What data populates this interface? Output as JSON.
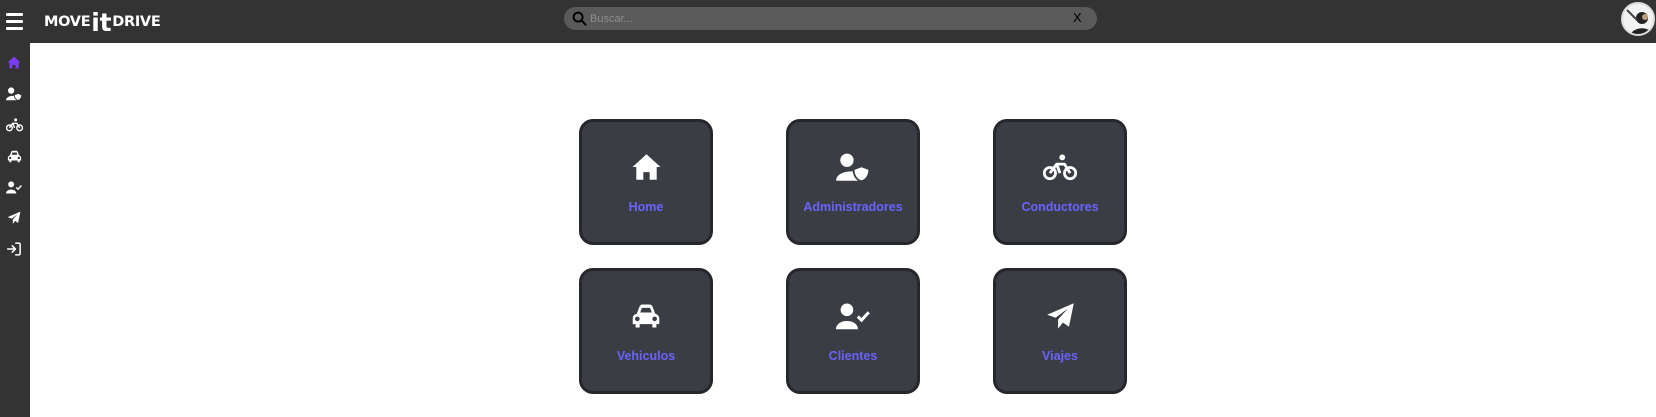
{
  "header": {
    "logo_left": "MOVE",
    "logo_mid": "it",
    "logo_right": "DRIVE",
    "search_placeholder": "Buscar...",
    "search_clear": "X"
  },
  "sidebar": {
    "items": [
      {
        "icon": "home-icon",
        "active": true
      },
      {
        "icon": "user-shield-icon"
      },
      {
        "icon": "bicycle-icon"
      },
      {
        "icon": "car-icon"
      },
      {
        "icon": "user-check-icon"
      },
      {
        "icon": "paper-plane-icon"
      },
      {
        "icon": "sign-in-icon"
      }
    ]
  },
  "cards": [
    {
      "label": "Home",
      "icon": "home-icon"
    },
    {
      "label": "Administradores",
      "icon": "user-shield-icon"
    },
    {
      "label": "Conductores",
      "icon": "bicycle-icon"
    },
    {
      "label": "Vehiculos",
      "icon": "car-icon"
    },
    {
      "label": "Clientes",
      "icon": "user-check-icon"
    },
    {
      "label": "Viajes",
      "icon": "paper-plane-icon"
    }
  ],
  "colors": {
    "topbar": "#333333",
    "card_bg": "#3b3d44",
    "card_label": "#6b63ff",
    "active_icon": "#7a3df5"
  }
}
